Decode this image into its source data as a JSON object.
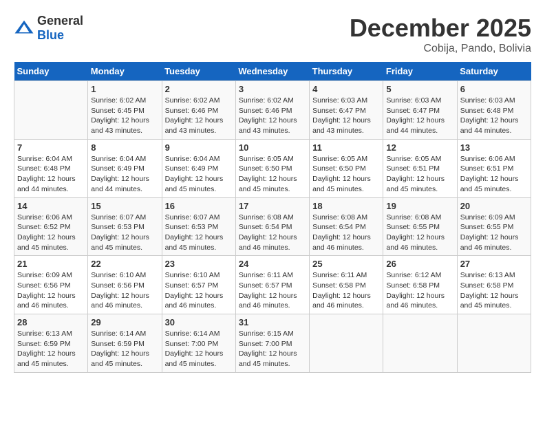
{
  "header": {
    "logo_general": "General",
    "logo_blue": "Blue",
    "month": "December 2025",
    "location": "Cobija, Pando, Bolivia"
  },
  "days_of_week": [
    "Sunday",
    "Monday",
    "Tuesday",
    "Wednesday",
    "Thursday",
    "Friday",
    "Saturday"
  ],
  "weeks": [
    [
      {
        "day": "",
        "info": ""
      },
      {
        "day": "1",
        "info": "Sunrise: 6:02 AM\nSunset: 6:45 PM\nDaylight: 12 hours\nand 43 minutes."
      },
      {
        "day": "2",
        "info": "Sunrise: 6:02 AM\nSunset: 6:46 PM\nDaylight: 12 hours\nand 43 minutes."
      },
      {
        "day": "3",
        "info": "Sunrise: 6:02 AM\nSunset: 6:46 PM\nDaylight: 12 hours\nand 43 minutes."
      },
      {
        "day": "4",
        "info": "Sunrise: 6:03 AM\nSunset: 6:47 PM\nDaylight: 12 hours\nand 43 minutes."
      },
      {
        "day": "5",
        "info": "Sunrise: 6:03 AM\nSunset: 6:47 PM\nDaylight: 12 hours\nand 44 minutes."
      },
      {
        "day": "6",
        "info": "Sunrise: 6:03 AM\nSunset: 6:48 PM\nDaylight: 12 hours\nand 44 minutes."
      }
    ],
    [
      {
        "day": "7",
        "info": "Sunrise: 6:04 AM\nSunset: 6:48 PM\nDaylight: 12 hours\nand 44 minutes."
      },
      {
        "day": "8",
        "info": "Sunrise: 6:04 AM\nSunset: 6:49 PM\nDaylight: 12 hours\nand 44 minutes."
      },
      {
        "day": "9",
        "info": "Sunrise: 6:04 AM\nSunset: 6:49 PM\nDaylight: 12 hours\nand 45 minutes."
      },
      {
        "day": "10",
        "info": "Sunrise: 6:05 AM\nSunset: 6:50 PM\nDaylight: 12 hours\nand 45 minutes."
      },
      {
        "day": "11",
        "info": "Sunrise: 6:05 AM\nSunset: 6:50 PM\nDaylight: 12 hours\nand 45 minutes."
      },
      {
        "day": "12",
        "info": "Sunrise: 6:05 AM\nSunset: 6:51 PM\nDaylight: 12 hours\nand 45 minutes."
      },
      {
        "day": "13",
        "info": "Sunrise: 6:06 AM\nSunset: 6:51 PM\nDaylight: 12 hours\nand 45 minutes."
      }
    ],
    [
      {
        "day": "14",
        "info": "Sunrise: 6:06 AM\nSunset: 6:52 PM\nDaylight: 12 hours\nand 45 minutes."
      },
      {
        "day": "15",
        "info": "Sunrise: 6:07 AM\nSunset: 6:53 PM\nDaylight: 12 hours\nand 45 minutes."
      },
      {
        "day": "16",
        "info": "Sunrise: 6:07 AM\nSunset: 6:53 PM\nDaylight: 12 hours\nand 45 minutes."
      },
      {
        "day": "17",
        "info": "Sunrise: 6:08 AM\nSunset: 6:54 PM\nDaylight: 12 hours\nand 46 minutes."
      },
      {
        "day": "18",
        "info": "Sunrise: 6:08 AM\nSunset: 6:54 PM\nDaylight: 12 hours\nand 46 minutes."
      },
      {
        "day": "19",
        "info": "Sunrise: 6:08 AM\nSunset: 6:55 PM\nDaylight: 12 hours\nand 46 minutes."
      },
      {
        "day": "20",
        "info": "Sunrise: 6:09 AM\nSunset: 6:55 PM\nDaylight: 12 hours\nand 46 minutes."
      }
    ],
    [
      {
        "day": "21",
        "info": "Sunrise: 6:09 AM\nSunset: 6:56 PM\nDaylight: 12 hours\nand 46 minutes."
      },
      {
        "day": "22",
        "info": "Sunrise: 6:10 AM\nSunset: 6:56 PM\nDaylight: 12 hours\nand 46 minutes."
      },
      {
        "day": "23",
        "info": "Sunrise: 6:10 AM\nSunset: 6:57 PM\nDaylight: 12 hours\nand 46 minutes."
      },
      {
        "day": "24",
        "info": "Sunrise: 6:11 AM\nSunset: 6:57 PM\nDaylight: 12 hours\nand 46 minutes."
      },
      {
        "day": "25",
        "info": "Sunrise: 6:11 AM\nSunset: 6:58 PM\nDaylight: 12 hours\nand 46 minutes."
      },
      {
        "day": "26",
        "info": "Sunrise: 6:12 AM\nSunset: 6:58 PM\nDaylight: 12 hours\nand 46 minutes."
      },
      {
        "day": "27",
        "info": "Sunrise: 6:13 AM\nSunset: 6:58 PM\nDaylight: 12 hours\nand 45 minutes."
      }
    ],
    [
      {
        "day": "28",
        "info": "Sunrise: 6:13 AM\nSunset: 6:59 PM\nDaylight: 12 hours\nand 45 minutes."
      },
      {
        "day": "29",
        "info": "Sunrise: 6:14 AM\nSunset: 6:59 PM\nDaylight: 12 hours\nand 45 minutes."
      },
      {
        "day": "30",
        "info": "Sunrise: 6:14 AM\nSunset: 7:00 PM\nDaylight: 12 hours\nand 45 minutes."
      },
      {
        "day": "31",
        "info": "Sunrise: 6:15 AM\nSunset: 7:00 PM\nDaylight: 12 hours\nand 45 minutes."
      },
      {
        "day": "",
        "info": ""
      },
      {
        "day": "",
        "info": ""
      },
      {
        "day": "",
        "info": ""
      }
    ]
  ]
}
